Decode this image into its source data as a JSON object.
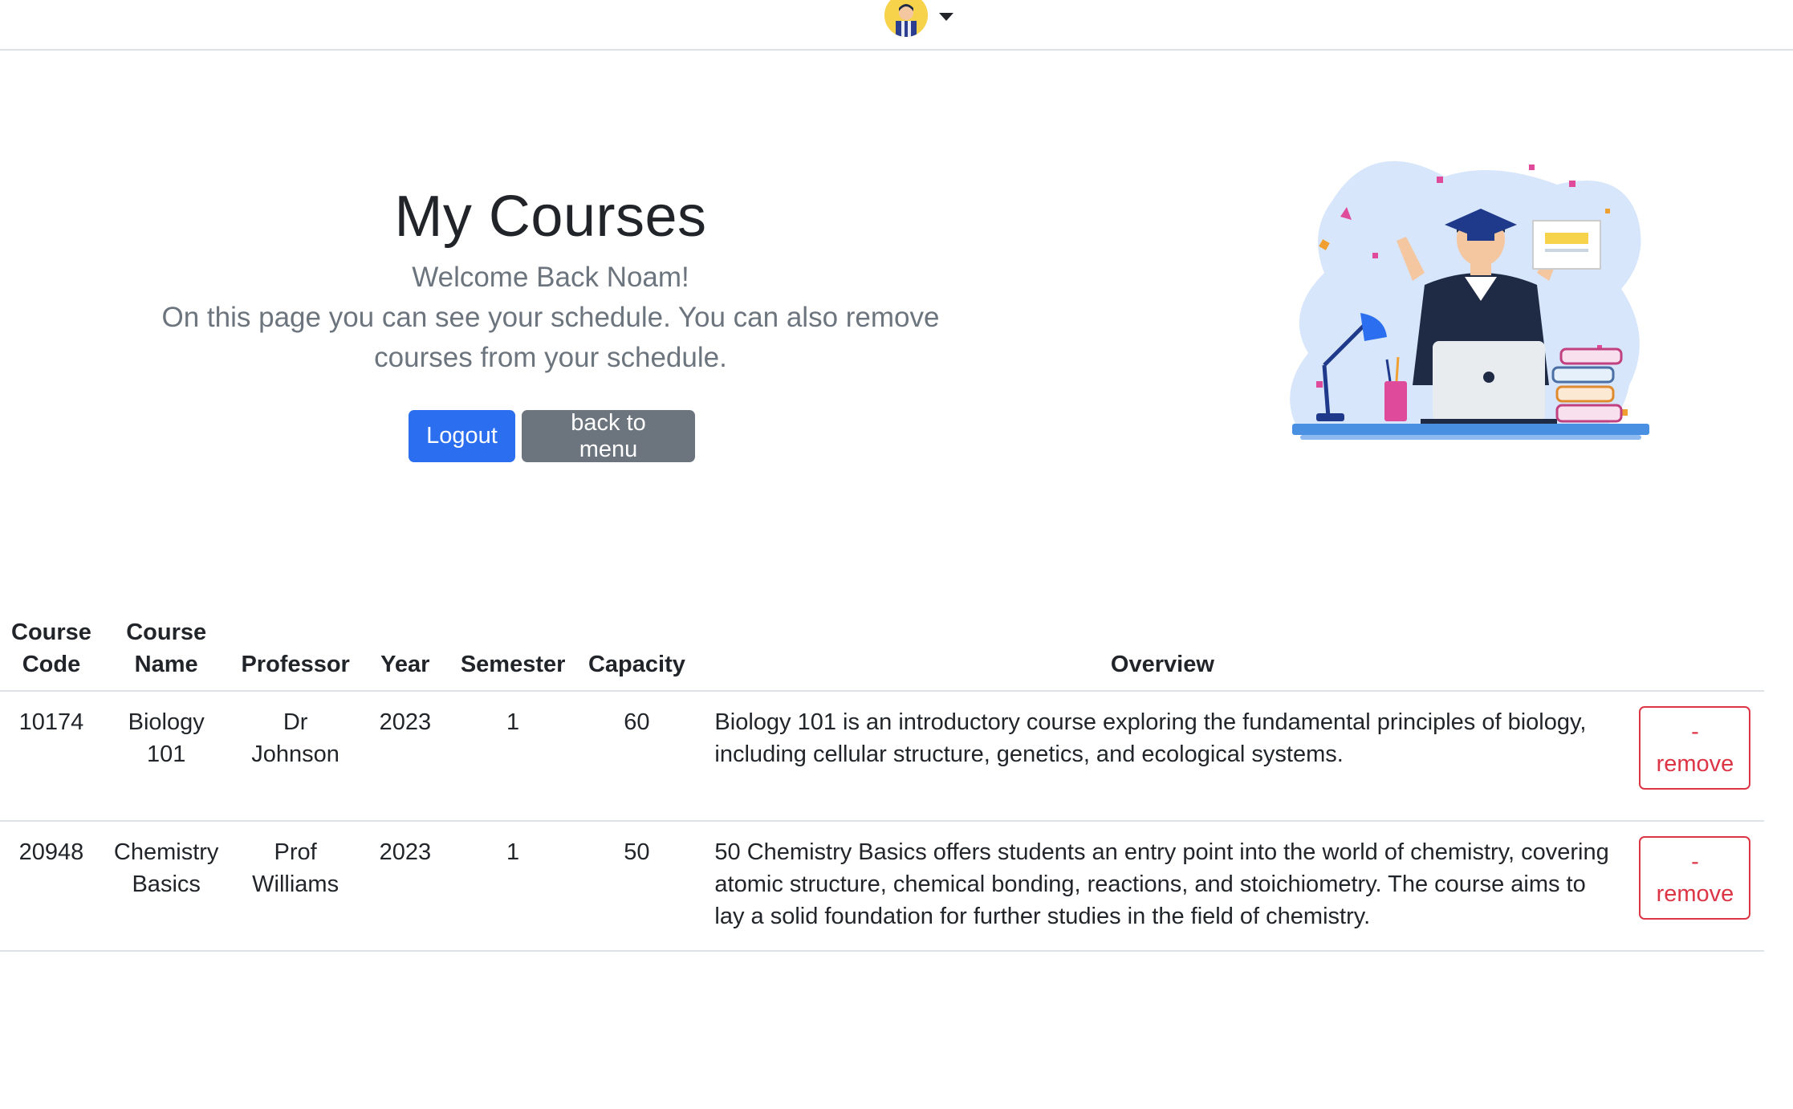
{
  "header": {
    "user_menu_label": "User menu"
  },
  "hero": {
    "title": "My Courses",
    "welcome": "Welcome Back Noam!",
    "description": "On this page you can see your schedule. You can also remove courses from your schedule.",
    "logout_label": "Logout",
    "back_label": "back to menu"
  },
  "table": {
    "headers": {
      "code_line1": "Course",
      "code_line2": "Code",
      "name_line1": "Course",
      "name_line2": "Name",
      "professor": "Professor",
      "year": "Year",
      "semester": "Semester",
      "capacity": "Capacity",
      "overview": "Overview"
    },
    "rows": [
      {
        "code": "10174",
        "name": "Biology 101",
        "professor": "Dr Johnson",
        "year": "2023",
        "semester": "1",
        "capacity": "60",
        "overview": "Biology 101 is an introductory course exploring the fundamental principles of biology, including cellular structure, genetics, and ecological systems.",
        "remove_dash": "-",
        "remove_label": "remove"
      },
      {
        "code": "20948",
        "name": "Chemistry Basics",
        "professor": "Prof Williams",
        "year": "2023",
        "semester": "1",
        "capacity": "50",
        "overview": "50 Chemistry Basics offers students an entry point into the world of chemistry, covering atomic structure, chemical bonding, reactions, and stoichiometry. The course aims to lay a solid foundation for further studies in the field of chemistry.",
        "remove_dash": "-",
        "remove_label": "remove"
      }
    ]
  },
  "colors": {
    "primary": "#2b6ef0",
    "secondary": "#6c757d",
    "danger": "#dc3545"
  }
}
